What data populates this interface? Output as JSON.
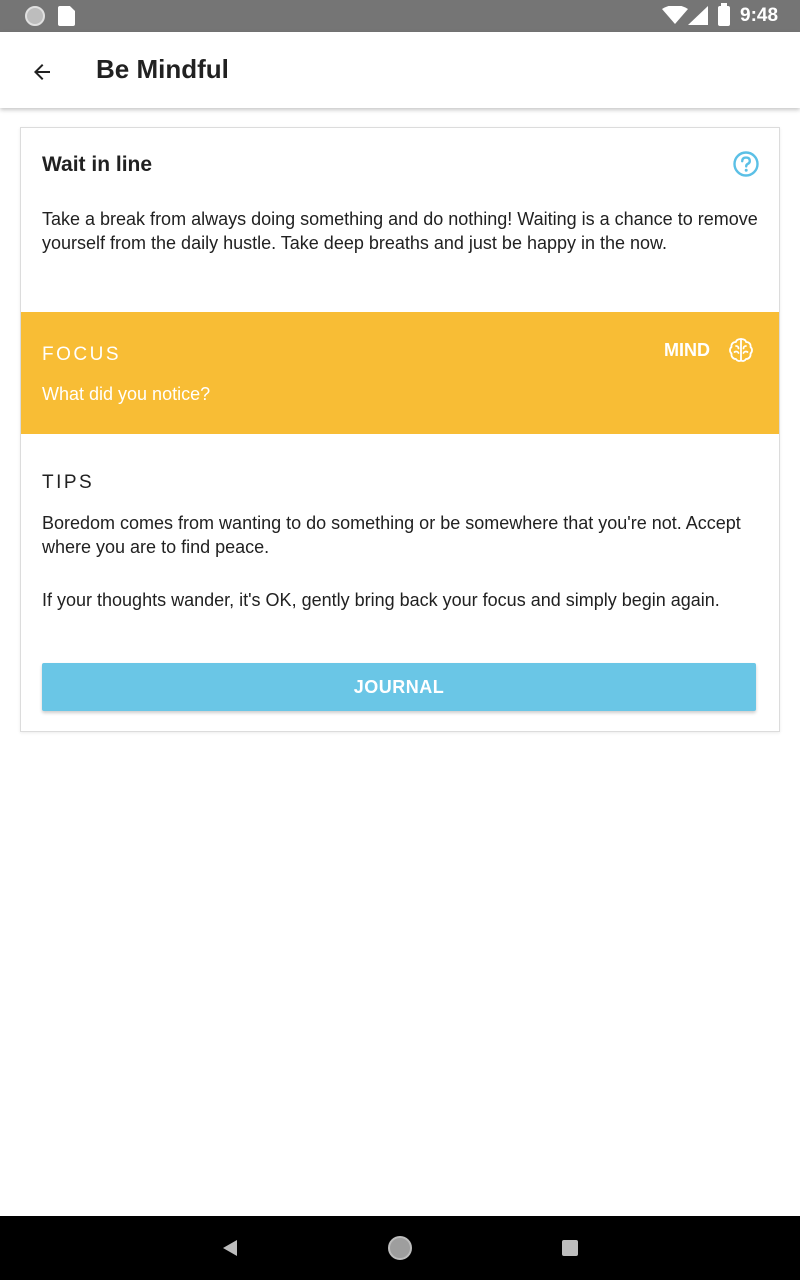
{
  "status_bar": {
    "time": "9:48"
  },
  "app_bar": {
    "title": "Be Mindful",
    "back_icon": "arrow-back-icon"
  },
  "card": {
    "title": "Wait in line",
    "help_icon": "help-circle-icon",
    "description": "Take a break from always doing something and do nothing! Waiting is a chance to remove yourself from the daily hustle. Take deep breaths and just be happy in the now.",
    "focus": {
      "label": "FOCUS",
      "question": "What did you notice?",
      "category": "MIND",
      "category_icon": "brain-icon",
      "color": "#f8bd35"
    },
    "tips": {
      "label": "TIPS",
      "items": [
        "Boredom comes from wanting to do something or be somewhere that you're not. Accept where you are to find peace.",
        "If your thoughts wander, it's OK, gently bring back your focus and simply begin again."
      ]
    },
    "journal_button": {
      "label": "JOURNAL",
      "color": "#6ac6e6"
    }
  },
  "accent_color": "#5bc0e6"
}
